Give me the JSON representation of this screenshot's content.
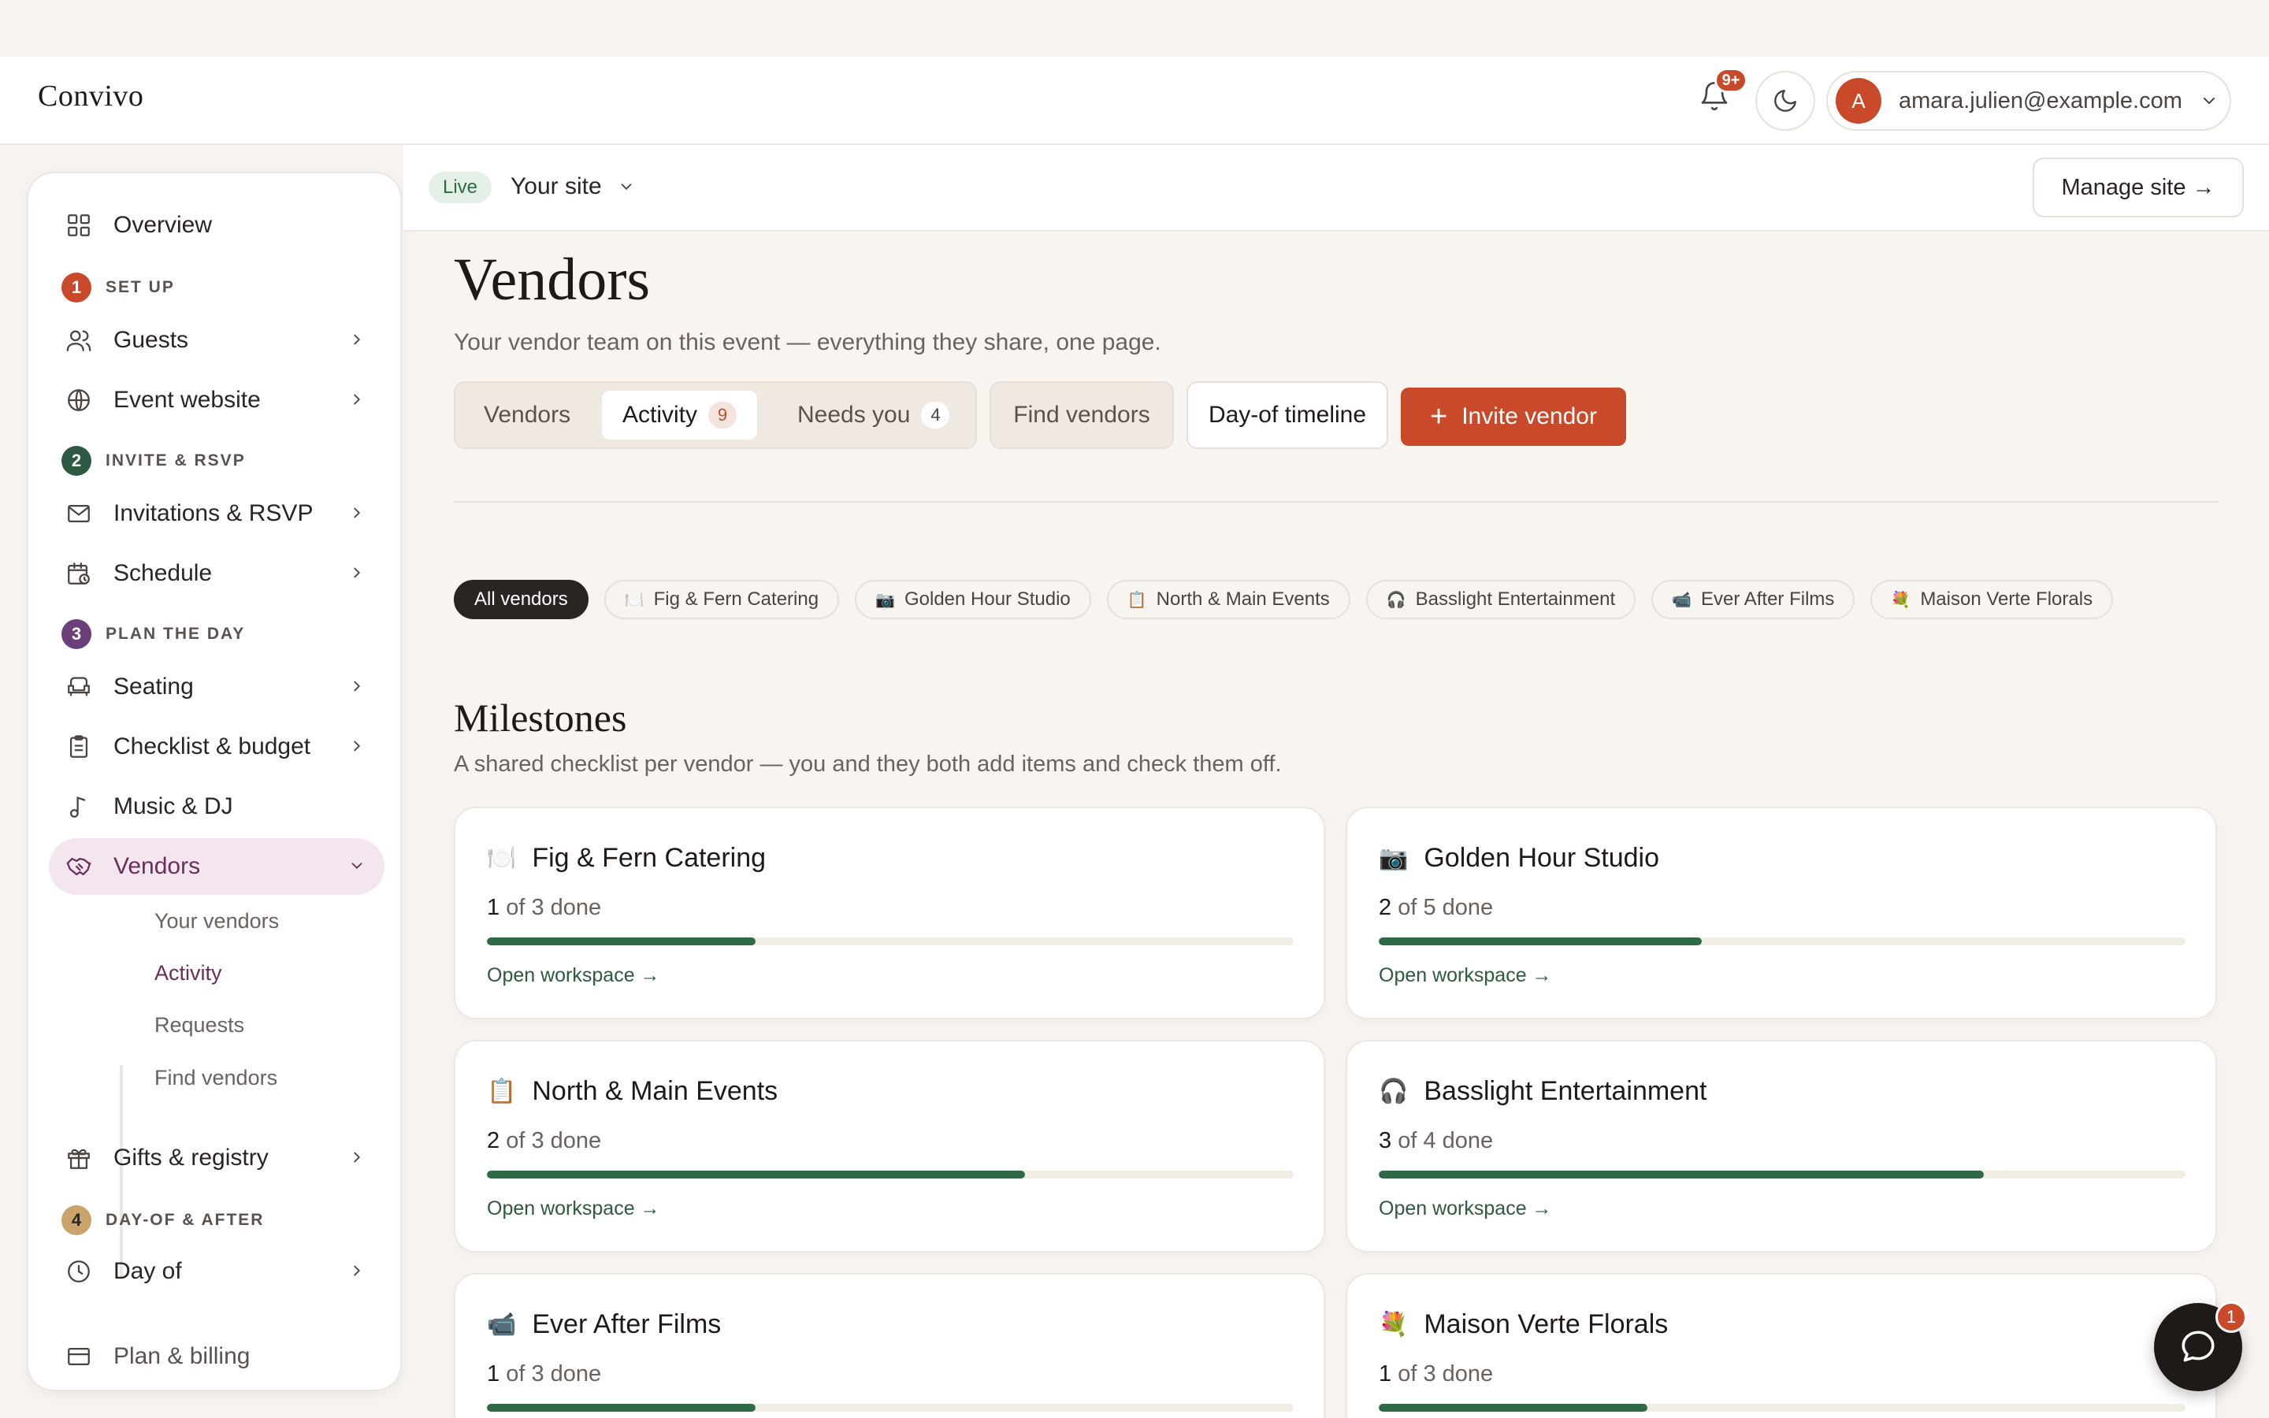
{
  "app": {
    "brand": "Convivo"
  },
  "header": {
    "notifications_badge": "9+",
    "account_initial": "A",
    "account_email": "amara.julien@example.com"
  },
  "sidebar": {
    "overview": "Overview",
    "sections": {
      "setup": {
        "step": "1",
        "label": "SET UP",
        "color": "#c94a2a"
      },
      "invite": {
        "step": "2",
        "label": "INVITE & RSVP",
        "color": "#2d5a40"
      },
      "plan": {
        "step": "3",
        "label": "PLAN THE DAY",
        "color": "#6a3f7a"
      },
      "dayof": {
        "step": "4",
        "label": "DAY-OF & AFTER",
        "color": "#c9a36a"
      }
    },
    "items": {
      "guests": "Guests",
      "event_website": "Event website",
      "invitations": "Invitations & RSVP",
      "schedule": "Schedule",
      "seating": "Seating",
      "checklist": "Checklist & budget",
      "music": "Music & DJ",
      "vendors": "Vendors",
      "gifts": "Gifts & registry",
      "day_of": "Day of",
      "billing": "Plan & billing"
    },
    "vendor_sub": {
      "your_vendors": "Your vendors",
      "activity": "Activity",
      "requests": "Requests",
      "find_vendors": "Find vendors"
    }
  },
  "sitebar": {
    "status": "Live",
    "site": "Your site",
    "manage": "Manage site →"
  },
  "page": {
    "title": "Vendors",
    "subtitle": "Your vendor team on this event — everything they share, one page.",
    "tabs": {
      "vendors": "Vendors",
      "activity": "Activity",
      "activity_count": "9",
      "needs_you": "Needs you",
      "needs_you_count": "4"
    },
    "find_vendors": "Find vendors",
    "day_of_timeline": "Day-of timeline",
    "invite_vendor": "Invite vendor"
  },
  "filters": {
    "all": "All vendors",
    "chips": [
      {
        "icon": "🍽️",
        "label": "Fig & Fern Catering"
      },
      {
        "icon": "📷",
        "label": "Golden Hour Studio"
      },
      {
        "icon": "📋",
        "label": "North & Main Events"
      },
      {
        "icon": "🎧",
        "label": "Basslight Entertainment"
      },
      {
        "icon": "📹",
        "label": "Ever After Films"
      },
      {
        "icon": "💐",
        "label": "Maison Verte Florals"
      }
    ]
  },
  "milestones": {
    "title": "Milestones",
    "subtitle": "A shared checklist per vendor — you and they both add items and check them off.",
    "open_label": "Open workspace →",
    "cards": [
      {
        "icon": "🍽️",
        "name": "Fig & Fern Catering",
        "done": "1",
        "of_text": "of 3 done",
        "progress": 0.333
      },
      {
        "icon": "📷",
        "name": "Golden Hour Studio",
        "done": "2",
        "of_text": "of 5 done",
        "progress": 0.4
      },
      {
        "icon": "📋",
        "name": "North & Main Events",
        "done": "2",
        "of_text": "of 3 done",
        "progress": 0.667
      },
      {
        "icon": "🎧",
        "name": "Basslight Entertainment",
        "done": "3",
        "of_text": "of 4 done",
        "progress": 0.75
      },
      {
        "icon": "📹",
        "name": "Ever After Films",
        "done": "1",
        "of_text": "of 3 done",
        "progress": 0.333
      },
      {
        "icon": "💐",
        "name": "Maison Verte Florals",
        "done": "1",
        "of_text": "of 3 done",
        "progress": 0.333
      }
    ]
  },
  "chat": {
    "badge": "1"
  }
}
